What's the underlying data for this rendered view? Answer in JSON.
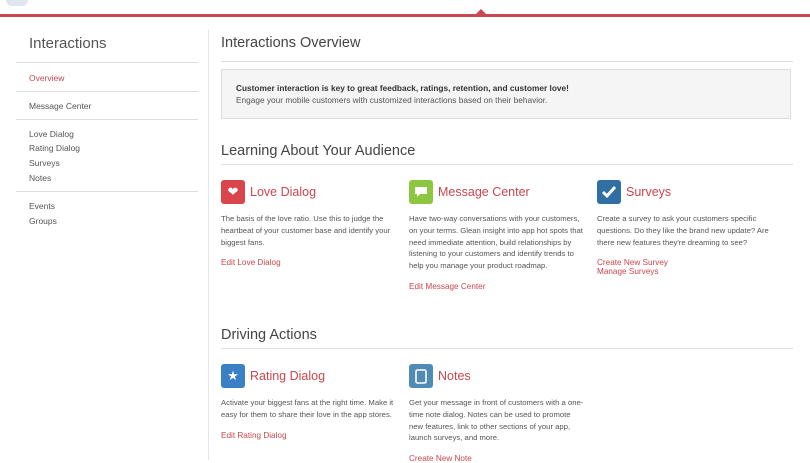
{
  "colors": {
    "accent": "#c9474e",
    "love": "#d9454b",
    "message": "#8dc63f",
    "surveys": "#2f6fa3",
    "rating": "#3b7fc4",
    "notes": "#4f8bb5"
  },
  "sidebar": {
    "title": "Interactions",
    "groups": [
      [
        {
          "label": "Overview",
          "active": true
        }
      ],
      [
        {
          "label": "Message Center"
        }
      ],
      [
        {
          "label": "Love Dialog"
        },
        {
          "label": "Rating Dialog"
        },
        {
          "label": "Surveys"
        },
        {
          "label": "Notes"
        }
      ],
      [
        {
          "label": "Events"
        },
        {
          "label": "Groups"
        }
      ]
    ]
  },
  "main": {
    "title": "Interactions Overview",
    "callout": {
      "strong": "Customer interaction is key to great feedback, ratings, retention, and customer love!",
      "sub": "Engage your mobile customers with customized interactions based on their behavior."
    },
    "sections": [
      {
        "title": "Learning About Your Audience",
        "cards": [
          {
            "icon": "heart-icon",
            "title": "Love Dialog",
            "desc": "The basis of the love ratio. Use this to judge the heartbeat of your customer base and identify your biggest fans.",
            "links": [
              "Edit Love Dialog"
            ]
          },
          {
            "icon": "chat-bubble-icon",
            "title": "Message Center",
            "desc": "Have two-way conversations with your customers, on your terms. Glean insight into app hot spots that need immediate attention, build relationships by listening to your customers and identify trends to help you manage your product roadmap.",
            "links": [
              "Edit Message Center"
            ]
          },
          {
            "icon": "checkmark-icon",
            "title": "Surveys",
            "desc": "Create a survey to ask your customers specific questions. Do they like the brand new update? Are there new features they're dreaming to see?",
            "links": [
              "Create New Survey",
              "Manage Surveys"
            ]
          }
        ]
      },
      {
        "title": "Driving Actions",
        "cards": [
          {
            "icon": "star-icon",
            "title": "Rating Dialog",
            "desc": "Activate your biggest fans at the right time. Make it easy for them to share their love in the app stores.",
            "links": [
              "Edit Rating Dialog"
            ]
          },
          {
            "icon": "note-icon",
            "title": "Notes",
            "desc": "Get your message in front of customers with a one-time note dialog. Notes can be used to promote new features, link to other sections of your app, launch surveys, and more.",
            "links": [
              "Create New Note"
            ]
          }
        ]
      }
    ]
  }
}
